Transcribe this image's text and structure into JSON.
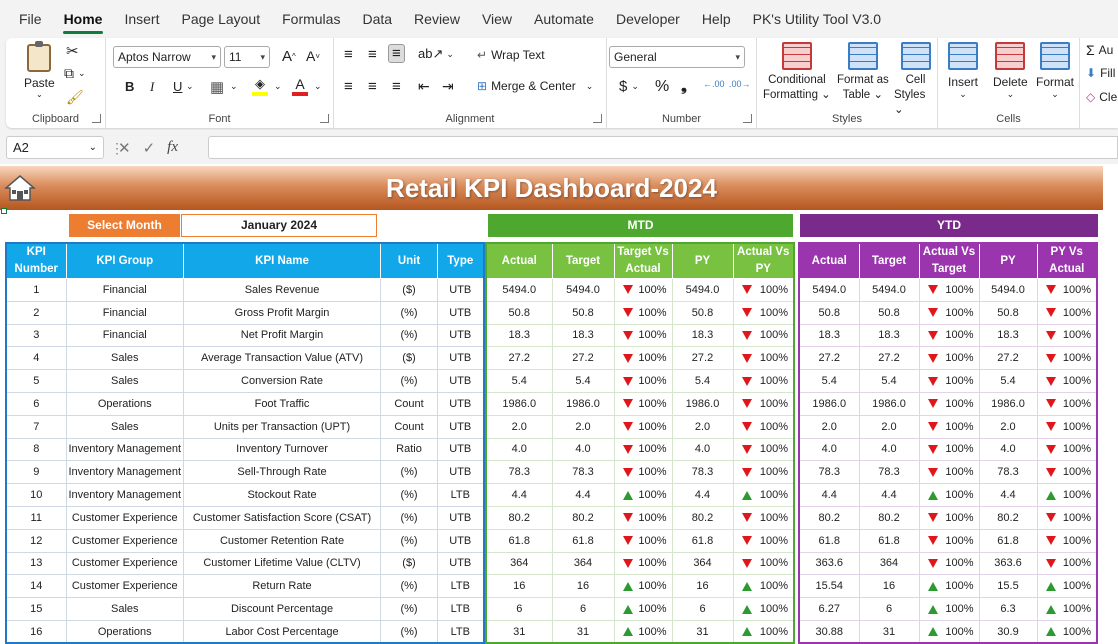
{
  "menu": [
    "File",
    "Home",
    "Insert",
    "Page Layout",
    "Formulas",
    "Data",
    "Review",
    "View",
    "Automate",
    "Developer",
    "Help",
    "PK's Utility Tool V3.0"
  ],
  "menu_active": "Home",
  "ribbon": {
    "clipboard": {
      "label": "Clipboard",
      "paste": "Paste"
    },
    "font": {
      "label": "Font",
      "name": "Aptos Narrow",
      "size": "11",
      "grow": "A^",
      "shrink": "A˅",
      "bold": "B",
      "italic": "I",
      "underline": "U"
    },
    "alignment": {
      "label": "Alignment",
      "wrap": "Wrap Text",
      "merge": "Merge & Center"
    },
    "number": {
      "label": "Number",
      "format": "General",
      "currency": "$",
      "percent": "%",
      "comma": "❟"
    },
    "styles": {
      "label": "Styles",
      "conditional_1": "Conditional",
      "conditional_2": "Formatting",
      "format_table_1": "Format as",
      "format_table_2": "Table",
      "cell_styles_1": "Cell",
      "cell_styles_2": "Styles"
    },
    "cells": {
      "label": "Cells",
      "insert": "Insert",
      "delete": "Delete",
      "format": "Format"
    },
    "editing": {
      "autosum": "Au",
      "fill": "Fill",
      "clear": "Cle"
    }
  },
  "formula_bar": {
    "name_box": "A2",
    "fx": "fx",
    "value": ""
  },
  "dashboard": {
    "title": "Retail KPI Dashboard-2024",
    "select_month_label": "Select Month",
    "selected_month": "January 2024",
    "mtd_label": "MTD",
    "ytd_label": "YTD",
    "kpi_headers": [
      "KPI Number",
      "KPI Group",
      "KPI Name",
      "Unit",
      "Type"
    ],
    "mtd_headers": [
      "Actual",
      "Target",
      "Target Vs Actual",
      "PY",
      "Actual Vs PY"
    ],
    "ytd_headers": [
      "Actual",
      "Target",
      "Actual Vs Target",
      "PY",
      "PY Vs Actual"
    ],
    "colors": {
      "banner": "#c46a32",
      "select": "#ed7d31",
      "kpi_header": "#11a7e8",
      "mtd": "#4ea72e",
      "mtd_header": "#78c141",
      "ytd": "#7a2a8b",
      "ytd_header": "#9a35ad",
      "down": "#e0161b",
      "up": "#2d9a2f"
    },
    "rows": [
      {
        "num": "1",
        "group": "Financial",
        "name": "Sales Revenue",
        "unit": "($)",
        "type": "UTB",
        "mtd": [
          "5494.0",
          "5494.0",
          "down",
          "100%",
          "5494.0",
          "down",
          "100%"
        ],
        "ytd": [
          "5494.0",
          "5494.0",
          "down",
          "100%",
          "5494.0",
          "down",
          "100%"
        ]
      },
      {
        "num": "2",
        "group": "Financial",
        "name": "Gross Profit Margin",
        "unit": "(%)",
        "type": "UTB",
        "mtd": [
          "50.8",
          "50.8",
          "down",
          "100%",
          "50.8",
          "down",
          "100%"
        ],
        "ytd": [
          "50.8",
          "50.8",
          "down",
          "100%",
          "50.8",
          "down",
          "100%"
        ]
      },
      {
        "num": "3",
        "group": "Financial",
        "name": "Net Profit Margin",
        "unit": "(%)",
        "type": "UTB",
        "mtd": [
          "18.3",
          "18.3",
          "down",
          "100%",
          "18.3",
          "down",
          "100%"
        ],
        "ytd": [
          "18.3",
          "18.3",
          "down",
          "100%",
          "18.3",
          "down",
          "100%"
        ]
      },
      {
        "num": "4",
        "group": "Sales",
        "name": "Average Transaction Value (ATV)",
        "unit": "($)",
        "type": "UTB",
        "mtd": [
          "27.2",
          "27.2",
          "down",
          "100%",
          "27.2",
          "down",
          "100%"
        ],
        "ytd": [
          "27.2",
          "27.2",
          "down",
          "100%",
          "27.2",
          "down",
          "100%"
        ]
      },
      {
        "num": "5",
        "group": "Sales",
        "name": "Conversion Rate",
        "unit": "(%)",
        "type": "UTB",
        "mtd": [
          "5.4",
          "5.4",
          "down",
          "100%",
          "5.4",
          "down",
          "100%"
        ],
        "ytd": [
          "5.4",
          "5.4",
          "down",
          "100%",
          "5.4",
          "down",
          "100%"
        ]
      },
      {
        "num": "6",
        "group": "Operations",
        "name": "Foot Traffic",
        "unit": "Count",
        "type": "UTB",
        "mtd": [
          "1986.0",
          "1986.0",
          "down",
          "100%",
          "1986.0",
          "down",
          "100%"
        ],
        "ytd": [
          "1986.0",
          "1986.0",
          "down",
          "100%",
          "1986.0",
          "down",
          "100%"
        ]
      },
      {
        "num": "7",
        "group": "Sales",
        "name": "Units per Transaction (UPT)",
        "unit": "Count",
        "type": "UTB",
        "mtd": [
          "2.0",
          "2.0",
          "down",
          "100%",
          "2.0",
          "down",
          "100%"
        ],
        "ytd": [
          "2.0",
          "2.0",
          "down",
          "100%",
          "2.0",
          "down",
          "100%"
        ]
      },
      {
        "num": "8",
        "group": "Inventory Management",
        "name": "Inventory Turnover",
        "unit": "Ratio",
        "type": "UTB",
        "mtd": [
          "4.0",
          "4.0",
          "down",
          "100%",
          "4.0",
          "down",
          "100%"
        ],
        "ytd": [
          "4.0",
          "4.0",
          "down",
          "100%",
          "4.0",
          "down",
          "100%"
        ]
      },
      {
        "num": "9",
        "group": "Inventory Management",
        "name": "Sell-Through Rate",
        "unit": "(%)",
        "type": "UTB",
        "mtd": [
          "78.3",
          "78.3",
          "down",
          "100%",
          "78.3",
          "down",
          "100%"
        ],
        "ytd": [
          "78.3",
          "78.3",
          "down",
          "100%",
          "78.3",
          "down",
          "100%"
        ]
      },
      {
        "num": "10",
        "group": "Inventory Management",
        "name": "Stockout Rate",
        "unit": "(%)",
        "type": "LTB",
        "mtd": [
          "4.4",
          "4.4",
          "up",
          "100%",
          "4.4",
          "up",
          "100%"
        ],
        "ytd": [
          "4.4",
          "4.4",
          "up",
          "100%",
          "4.4",
          "up",
          "100%"
        ]
      },
      {
        "num": "11",
        "group": "Customer Experience",
        "name": "Customer Satisfaction Score (CSAT)",
        "unit": "(%)",
        "type": "UTB",
        "mtd": [
          "80.2",
          "80.2",
          "down",
          "100%",
          "80.2",
          "down",
          "100%"
        ],
        "ytd": [
          "80.2",
          "80.2",
          "down",
          "100%",
          "80.2",
          "down",
          "100%"
        ]
      },
      {
        "num": "12",
        "group": "Customer Experience",
        "name": "Customer Retention Rate",
        "unit": "(%)",
        "type": "UTB",
        "mtd": [
          "61.8",
          "61.8",
          "down",
          "100%",
          "61.8",
          "down",
          "100%"
        ],
        "ytd": [
          "61.8",
          "61.8",
          "down",
          "100%",
          "61.8",
          "down",
          "100%"
        ]
      },
      {
        "num": "13",
        "group": "Customer Experience",
        "name": "Customer Lifetime Value (CLTV)",
        "unit": "($)",
        "type": "UTB",
        "mtd": [
          "364",
          "364",
          "down",
          "100%",
          "364",
          "down",
          "100%"
        ],
        "ytd": [
          "363.6",
          "364",
          "down",
          "100%",
          "363.6",
          "down",
          "100%"
        ]
      },
      {
        "num": "14",
        "group": "Customer Experience",
        "name": "Return Rate",
        "unit": "(%)",
        "type": "LTB",
        "mtd": [
          "16",
          "16",
          "up",
          "100%",
          "16",
          "up",
          "100%"
        ],
        "ytd": [
          "15.54",
          "16",
          "up",
          "100%",
          "15.5",
          "up",
          "100%"
        ]
      },
      {
        "num": "15",
        "group": "Sales",
        "name": "Discount Percentage",
        "unit": "(%)",
        "type": "LTB",
        "mtd": [
          "6",
          "6",
          "up",
          "100%",
          "6",
          "up",
          "100%"
        ],
        "ytd": [
          "6.27",
          "6",
          "up",
          "100%",
          "6.3",
          "up",
          "100%"
        ]
      },
      {
        "num": "16",
        "group": "Operations",
        "name": "Labor Cost Percentage",
        "unit": "(%)",
        "type": "LTB",
        "mtd": [
          "31",
          "31",
          "up",
          "100%",
          "31",
          "up",
          "100%"
        ],
        "ytd": [
          "30.88",
          "31",
          "up",
          "100%",
          "30.9",
          "up",
          "100%"
        ]
      }
    ]
  }
}
